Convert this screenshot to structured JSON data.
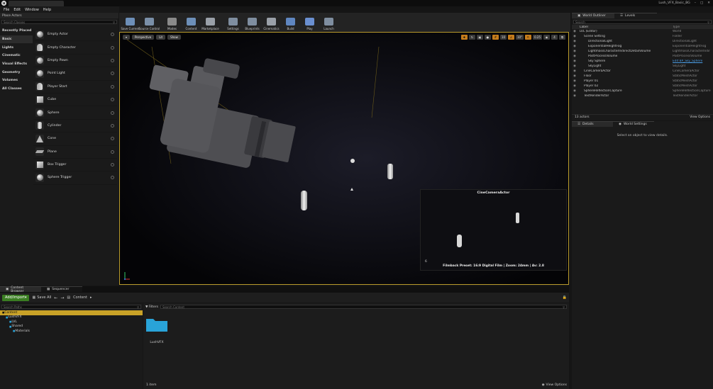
{
  "app": {
    "logo": "unreal-logo",
    "tab_title": "",
    "window_title": "Lush_VFX_Basic_BG"
  },
  "menu": [
    "File",
    "Edit",
    "Window",
    "Help"
  ],
  "place_actors": {
    "panel_title": "Place Actors",
    "search_placeholder": "Search Classes",
    "categories": [
      "Recently Placed",
      "Basic",
      "Lights",
      "Cinematic",
      "Visual Effects",
      "Geometry",
      "Volumes",
      "All Classes"
    ],
    "active_category": "Basic",
    "items": [
      {
        "label": "Empty Actor",
        "icon": "sphere"
      },
      {
        "label": "Empty Character",
        "icon": "pawn"
      },
      {
        "label": "Empty Pawn",
        "icon": "sphere"
      },
      {
        "label": "Point Light",
        "icon": "sphere"
      },
      {
        "label": "Player Start",
        "icon": "pawn"
      },
      {
        "label": "Cube",
        "icon": "box"
      },
      {
        "label": "Sphere",
        "icon": "sphere"
      },
      {
        "label": "Cylinder",
        "icon": "cyl"
      },
      {
        "label": "Cone",
        "icon": "cone"
      },
      {
        "label": "Plane",
        "icon": "plane"
      },
      {
        "label": "Box Trigger",
        "icon": "box"
      },
      {
        "label": "Sphere Trigger",
        "icon": "sphere"
      }
    ]
  },
  "toolbar": [
    {
      "label": "Save Current",
      "color": "#6d8fb8"
    },
    {
      "label": "Source Control",
      "color": "#7a8fa8"
    },
    {
      "label": "Modes",
      "color": "#8a8a8a"
    },
    {
      "label": "Content",
      "color": "#6d8fb8"
    },
    {
      "label": "Marketplace",
      "color": "#9aa0a8"
    },
    {
      "label": "Settings",
      "color": "#7f8ea0"
    },
    {
      "label": "Blueprints",
      "color": "#7f8ea0"
    },
    {
      "label": "Cinematics",
      "color": "#9aa0a8"
    },
    {
      "label": "Build",
      "color": "#5f86c0"
    },
    {
      "label": "Play",
      "color": "#6a8fd0"
    },
    {
      "label": "Launch",
      "color": "#7f8ea0"
    }
  ],
  "viewport": {
    "buttons": [
      "Perspective",
      "Lit",
      "Show"
    ],
    "snap": [
      "10",
      "10°",
      "0.25",
      "4"
    ],
    "cine_title": "CineCameraActor",
    "cine_footer": "Filmback Preset: 16:9 Digital Film | Zoom: 24mm | Av: 2.8",
    "cine_number": "6"
  },
  "outliner": {
    "tabs": [
      "World Outliner",
      "Levels"
    ],
    "search_placeholder": "Search",
    "col_label": "Label",
    "col_type": "Type",
    "rows": [
      {
        "name": "LVL (Editor)",
        "type": "World",
        "indent": 0,
        "link": false
      },
      {
        "name": "Scene Setting",
        "type": "Folder",
        "indent": 1,
        "link": false
      },
      {
        "name": "DirectionalLight",
        "type": "DirectionalLight",
        "indent": 2,
        "link": false
      },
      {
        "name": "ExponentialHeightFog",
        "type": "ExponentialHeightFog",
        "indent": 2,
        "link": false
      },
      {
        "name": "LightmassCharacterIndirectDetailVolume",
        "type": "LightmassCharacterIndir",
        "indent": 2,
        "link": false
      },
      {
        "name": "PostProcessVolume",
        "type": "PostProcessVolume",
        "indent": 2,
        "link": false
      },
      {
        "name": "Sky Sphere",
        "type": "Edit BP_Sky_Sphere",
        "indent": 2,
        "link": true
      },
      {
        "name": "SkyLight",
        "type": "SkyLight",
        "indent": 2,
        "link": false
      },
      {
        "name": "CineCameraActor",
        "type": "CineCameraActor",
        "indent": 1,
        "link": false
      },
      {
        "name": "Floor",
        "type": "StaticMeshActor",
        "indent": 1,
        "link": false
      },
      {
        "name": "Player 01",
        "type": "StaticMeshActor",
        "indent": 1,
        "link": false
      },
      {
        "name": "Player 02",
        "type": "StaticMeshActor",
        "indent": 1,
        "link": false
      },
      {
        "name": "SphereReflectionCapture",
        "type": "SphereReflectionCapture",
        "indent": 1,
        "link": false
      },
      {
        "name": "TextRenderActor",
        "type": "TextRenderActor",
        "indent": 1,
        "link": false
      }
    ],
    "count": "13 actors",
    "view_options": "View Options"
  },
  "details": {
    "tabs": [
      "Details",
      "World Settings"
    ],
    "empty": "Select an object to view details."
  },
  "content_browser": {
    "tabs": [
      "Content Browser",
      "Sequencer"
    ],
    "add_import": "Add/Import",
    "save_all": "Save All",
    "path": "Content",
    "search_paths": "Search Paths",
    "filters": "Filters",
    "search_content": "Search Content",
    "tree": [
      {
        "label": "Content",
        "indent": 0,
        "selected": true
      },
      {
        "label": "LushVFX",
        "indent": 1,
        "selected": false
      },
      {
        "label": "LVL",
        "indent": 2,
        "selected": false
      },
      {
        "label": "Shared",
        "indent": 2,
        "selected": false
      },
      {
        "label": "Materials",
        "indent": 3,
        "selected": false
      }
    ],
    "folder": "LushVFX",
    "count": "1 item",
    "view_options": "View Options"
  },
  "colors": {
    "accent": "#b89a2b",
    "folder": "#29a3d8",
    "add": "#3a7d22",
    "link": "#4a9ae0",
    "snap": "#c57c1b"
  }
}
